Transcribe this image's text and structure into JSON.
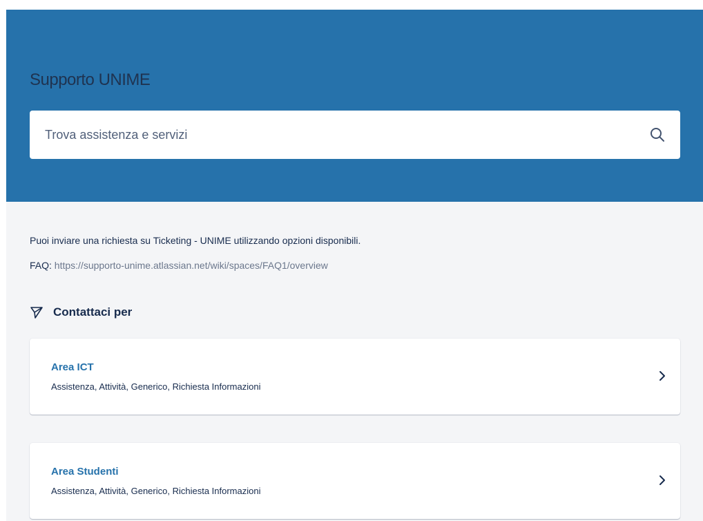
{
  "hero": {
    "title": "Supporto UNIME",
    "background_color": "#2672ab",
    "search": {
      "placeholder": "Trova assistenza e servizi",
      "value": "",
      "icon": "search-icon"
    }
  },
  "intro": {
    "text": "Puoi inviare una richiesta su Ticketing - UNIME utilizzando opzioni disponibili.",
    "faq_label": "FAQ:",
    "faq_link": "https://supporto-unime.atlassian.net/wiki/spaces/FAQ1/overview"
  },
  "contact": {
    "heading": "Contattaci per",
    "icon": "send-icon",
    "areas": [
      {
        "title": "Area ICT",
        "description": "Assistenza, Attività, Generico, Richiesta Informazioni",
        "icon": "chevron-right-icon"
      },
      {
        "title": "Area Studenti",
        "description": "Assistenza, Attività, Generico, Richiesta Informazioni",
        "icon": "chevron-right-icon"
      }
    ]
  },
  "colors": {
    "accent": "#2672ab",
    "text": "#172b4d",
    "muted": "#6b778c",
    "page_background": "#f4f5f7"
  }
}
